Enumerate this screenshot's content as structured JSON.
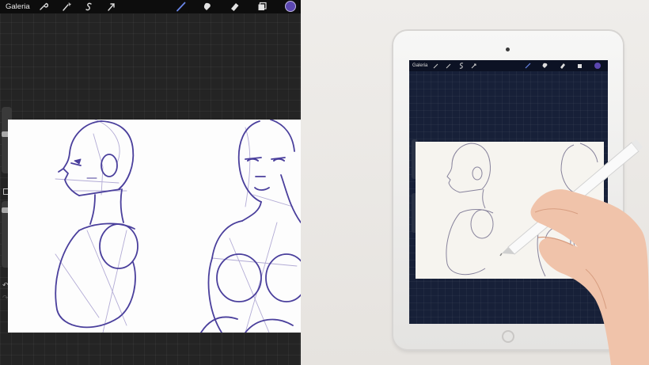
{
  "app": {
    "gallery_label": "Galeria",
    "brush_color": "#5b47b0",
    "toolbar_icons": [
      "wrench-icon",
      "magic-wand-icon",
      "selection-icon",
      "transform-arrow-icon",
      "brush-icon",
      "smudge-icon",
      "eraser-icon",
      "layers-icon",
      "color-icon"
    ],
    "sidebar": {
      "brush_size": "slider",
      "opacity": "slider",
      "modify_button": "square",
      "undo": "↶",
      "redo": "↷"
    }
  },
  "photo": {
    "device": "iPad with Apple Pencil",
    "mini_gallery_label": "Galeria"
  }
}
